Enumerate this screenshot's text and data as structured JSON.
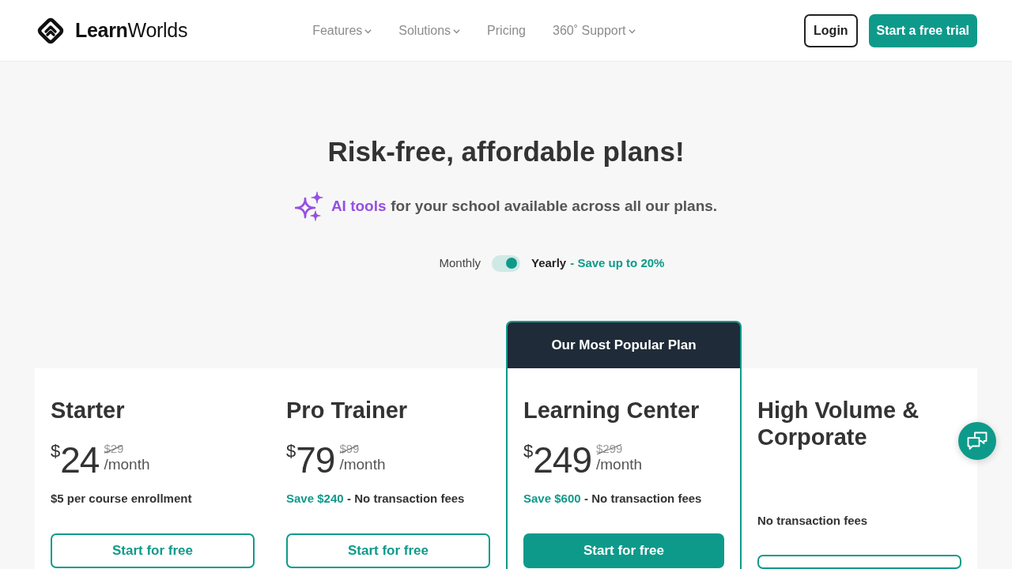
{
  "header": {
    "logo": "**Learn**Worlds",
    "nav": [
      {
        "label": "Features",
        "dropdown": true
      },
      {
        "label": "Solutions",
        "dropdown": true
      },
      {
        "label": "Pricing",
        "dropdown": false
      },
      {
        "label": "360˚ Support",
        "dropdown": true
      }
    ],
    "login": "Login",
    "cta": "Start a free trial"
  },
  "hero": {
    "title": "Risk-free, affordable plans!",
    "subtitle": {
      "link": "AI tools",
      "text": "for your school available across all our plans."
    }
  },
  "billing": {
    "options": [
      {
        "label": "Monthly",
        "selected": false
      },
      {
        "label": "Yearly",
        "selected": true
      }
    ],
    "savings": "- Save up to 20%"
  },
  "plans": [
    {
      "name": "Starter",
      "featured": false,
      "currency": "$",
      "price": "24",
      "old_price": "$29",
      "period": "/month",
      "note": "$5 per course enrollment",
      "button": {
        "label": "Start for free",
        "filled": false
      }
    },
    {
      "name": "Pro Trainer",
      "featured": false,
      "currency": "$",
      "price": "79",
      "old_price": "$99",
      "period": "/month",
      "savings": "Save $240",
      "note": "- No transaction fees",
      "button": {
        "label": "Start for free",
        "filled": false
      }
    },
    {
      "name": "Learning Center",
      "featured": true,
      "badge": "Our Most Popular Plan",
      "currency": "$",
      "price": "249",
      "old_price": "$299",
      "period": "/month",
      "savings": "Save $600",
      "note": "- No transaction fees",
      "button": {
        "label": "Start for free",
        "filled": true
      }
    },
    {
      "name": "High Volume & Corporate",
      "featured": false,
      "note": "No transaction fees",
      "button": {
        "filled": false
      }
    }
  ]
}
